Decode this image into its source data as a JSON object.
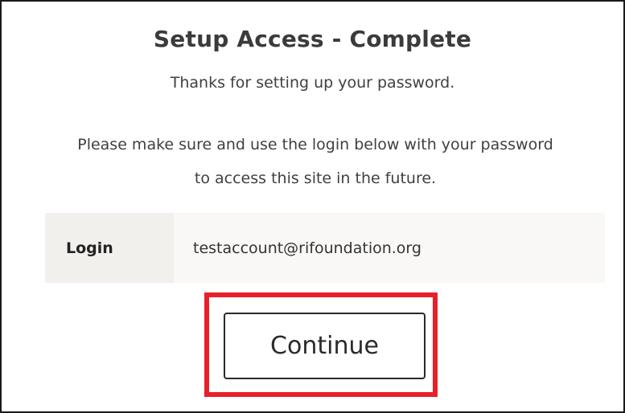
{
  "dialog": {
    "title": "Setup Access - Complete",
    "subtitle": "Thanks for setting up your password.",
    "message": "Please make sure and use the login below with your password to access this site in the future."
  },
  "login": {
    "label": "Login",
    "value": "testaccount@rifoundation.org"
  },
  "actions": {
    "continue_label": "Continue"
  },
  "colors": {
    "highlight": "#e8202a",
    "label_cell_bg": "#f2f0ec",
    "row_bg": "#f9f8f6"
  }
}
